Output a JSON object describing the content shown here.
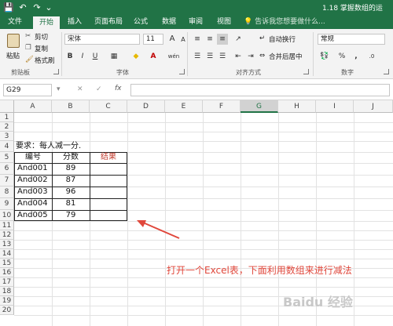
{
  "app": {
    "title": "1.18 掌握数组的运",
    "quick_access": {
      "save": "💾",
      "undo": "↶",
      "redo": "↷",
      "more": "⌄"
    }
  },
  "colors": {
    "accent": "#217346",
    "annotation": "#e0473b",
    "result_header": "#c0392b"
  },
  "tabs": [
    {
      "label": "文件",
      "active": false
    },
    {
      "label": "开始",
      "active": true
    },
    {
      "label": "插入",
      "active": false
    },
    {
      "label": "页面布局",
      "active": false
    },
    {
      "label": "公式",
      "active": false
    },
    {
      "label": "数据",
      "active": false
    },
    {
      "label": "审阅",
      "active": false
    },
    {
      "label": "视图",
      "active": false
    }
  ],
  "tell_me": {
    "icon": "lightbulb-icon",
    "text": "告诉我您想要做什么..."
  },
  "ribbon": {
    "clipboard": {
      "paste": "粘贴",
      "cut": "剪切",
      "copy": "复制",
      "format_painter": "格式刷",
      "group": "剪贴板"
    },
    "font": {
      "font_name": "宋体",
      "font_size": "11",
      "bold": "B",
      "italic": "I",
      "underline": "U",
      "grow": "A",
      "shrink": "A",
      "wen": "wén",
      "group": "字体"
    },
    "alignment": {
      "wrap": "自动换行",
      "merge": "合并后居中",
      "group": "对齐方式"
    },
    "number": {
      "format": "常规",
      "percent": "%",
      "comma": ",",
      "group": "数字"
    }
  },
  "formula_bar": {
    "name_box": "G29",
    "cancel": "✕",
    "enter": "✓",
    "fx": "fx",
    "value": ""
  },
  "grid": {
    "columns": [
      "A",
      "B",
      "C",
      "D",
      "E",
      "F",
      "G",
      "H",
      "I",
      "J"
    ],
    "selected_column": "G",
    "rows": [
      "1",
      "2",
      "3",
      "4",
      "5",
      "6",
      "7",
      "8",
      "9",
      "10",
      "11",
      "12",
      "13",
      "14",
      "15",
      "16",
      "17",
      "18",
      "19",
      "20"
    ],
    "requirement": "要求：每人减一分.",
    "headers": {
      "id": "编号",
      "score": "分数",
      "result": "结果"
    },
    "records": [
      {
        "id": "And001",
        "score": "89"
      },
      {
        "id": "And002",
        "score": "87"
      },
      {
        "id": "And003",
        "score": "96"
      },
      {
        "id": "And004",
        "score": "81"
      },
      {
        "id": "And005",
        "score": "79"
      }
    ]
  },
  "annotation": "打开一个Excel表，下面利用数组来进行减法",
  "watermark": "Baidu 经验"
}
